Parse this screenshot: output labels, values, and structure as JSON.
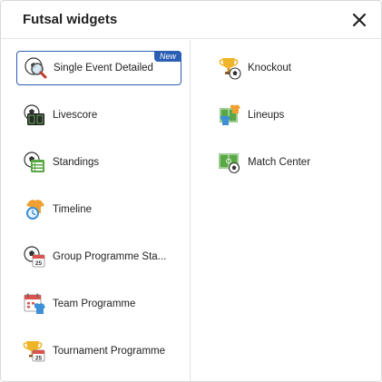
{
  "dialog": {
    "title": "Futsal widgets",
    "close_icon": "close-icon"
  },
  "left_items": [
    {
      "label": "Single Event Detailed",
      "icon": "ball-magnifier-icon",
      "badge": "New",
      "selected": true
    },
    {
      "label": "Livescore",
      "icon": "scoreboard-ball-icon"
    },
    {
      "label": "Standings",
      "icon": "ball-table-icon"
    },
    {
      "label": "Timeline",
      "icon": "jersey-clock-icon"
    },
    {
      "label": "Group Programme Sta...",
      "icon": "ball-calendar-icon"
    },
    {
      "label": "Team Programme",
      "icon": "calendar-jersey-icon"
    },
    {
      "label": "Tournament Programme",
      "icon": "trophy-calendar-icon"
    }
  ],
  "right_items": [
    {
      "label": "Knockout",
      "icon": "trophy-ball-icon"
    },
    {
      "label": "Lineups",
      "icon": "field-jerseys-icon"
    },
    {
      "label": "Match Center",
      "icon": "field-ball-icon"
    }
  ],
  "colors": {
    "accent": "#2b5fb4",
    "pitch_green": "#5aa845",
    "trophy_gold": "#f0b429",
    "calendar_red": "#d9534f",
    "jersey_blue": "#3d8fd6"
  }
}
